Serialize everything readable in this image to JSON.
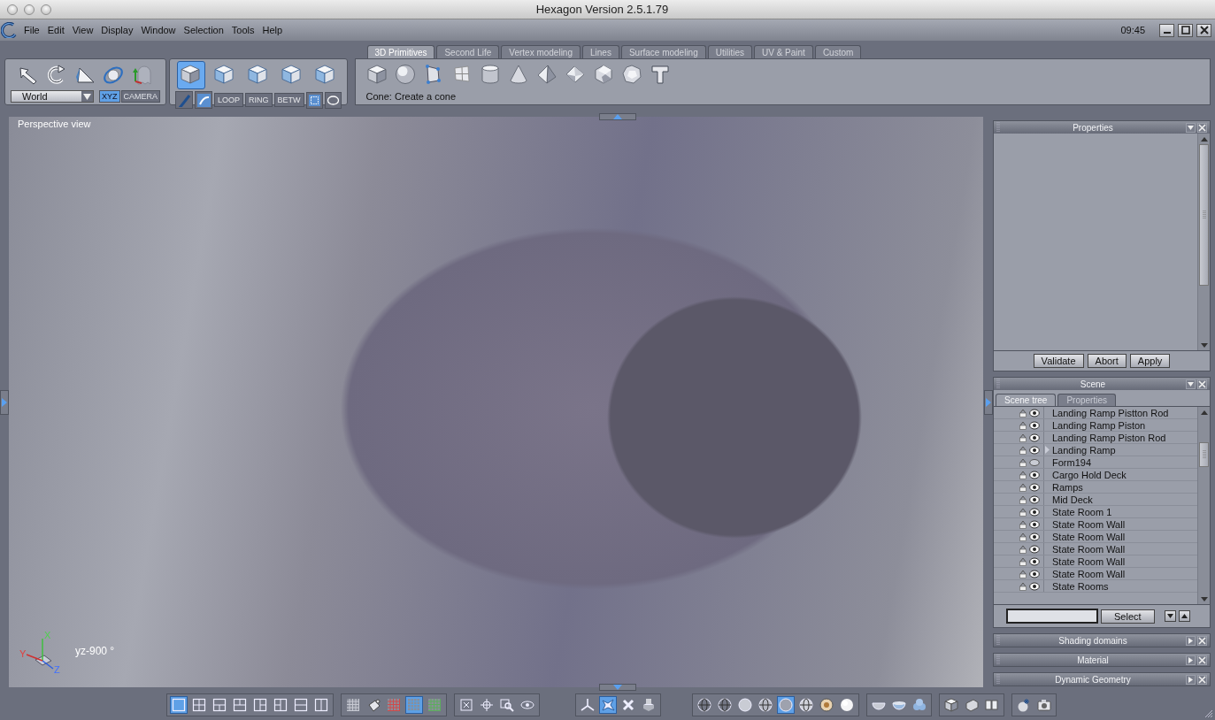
{
  "window": {
    "title": "Hexagon Version 2.5.1.79"
  },
  "menu": {
    "items": [
      "File",
      "Edit",
      "View",
      "Display",
      "Window",
      "Selection",
      "Tools",
      "Help"
    ],
    "clock": "09:45"
  },
  "left_toolbar": {
    "coordinate_space": "World",
    "space_toggles": [
      {
        "label": "XYZ",
        "selected": true
      },
      {
        "label": "CAMERA",
        "selected": false
      }
    ],
    "selection_modes": [
      {
        "selected": true
      },
      {
        "selected": false
      },
      {
        "selected": false
      },
      {
        "selected": false
      },
      {
        "selected": false
      }
    ],
    "edge_tools": [
      "LOOP",
      "RING",
      "BETW"
    ]
  },
  "tool_tabs": [
    {
      "label": "3D Primitives",
      "selected": true
    },
    {
      "label": "Second Life",
      "selected": false
    },
    {
      "label": "Vertex modeling",
      "selected": false
    },
    {
      "label": "Lines",
      "selected": false
    },
    {
      "label": "Surface modeling",
      "selected": false
    },
    {
      "label": "Utilities",
      "selected": false
    },
    {
      "label": "UV & Paint",
      "selected": false
    },
    {
      "label": "Custom",
      "selected": false
    }
  ],
  "tool_hint": "Cone: Create a cone",
  "viewport": {
    "label": "Perspective view",
    "axis_labels": [
      "X",
      "Y",
      "Z"
    ],
    "readout": "yz-900 °"
  },
  "properties_panel": {
    "title": "Properties",
    "buttons": [
      "Validate",
      "Abort",
      "Apply"
    ]
  },
  "scene_panel": {
    "title": "Scene",
    "tabs": [
      {
        "label": "Scene tree",
        "selected": true
      },
      {
        "label": "Properties",
        "selected": false
      }
    ],
    "rows": [
      {
        "name": "Landing Ramp Pistton Rod",
        "visible": true,
        "kind": "object"
      },
      {
        "name": "Landing Ramp Piston",
        "visible": true,
        "kind": "object"
      },
      {
        "name": "Landing Ramp Piston Rod",
        "visible": true,
        "kind": "object"
      },
      {
        "name": "Landing Ramp",
        "visible": true,
        "kind": "group"
      },
      {
        "name": "Form194",
        "visible": false,
        "kind": "object"
      },
      {
        "name": "Cargo Hold Deck",
        "visible": true,
        "kind": "object"
      },
      {
        "name": "Ramps",
        "visible": true,
        "kind": "object"
      },
      {
        "name": "Mid Deck",
        "visible": true,
        "kind": "object"
      },
      {
        "name": "State Room 1",
        "visible": true,
        "kind": "object"
      },
      {
        "name": "State Room Wall",
        "visible": true,
        "kind": "object"
      },
      {
        "name": "State Room Wall",
        "visible": true,
        "kind": "object"
      },
      {
        "name": "State Room Wall",
        "visible": true,
        "kind": "object"
      },
      {
        "name": "State Room Wall",
        "visible": true,
        "kind": "object"
      },
      {
        "name": "State Room Wall",
        "visible": true,
        "kind": "object"
      },
      {
        "name": "State Rooms",
        "visible": true,
        "kind": "object"
      }
    ],
    "select_button": "Select"
  },
  "collapsed_panels": [
    "Shading domains",
    "Material",
    "Dynamic Geometry"
  ],
  "bottom_toolbar": [
    {
      "buttons": [
        {
          "selected": true
        },
        {
          "selected": false
        },
        {
          "selected": false
        },
        {
          "selected": false
        },
        {
          "selected": false
        },
        {
          "selected": false
        },
        {
          "selected": false
        },
        {
          "selected": false
        }
      ]
    },
    {
      "buttons": [
        {
          "selected": false
        },
        {
          "selected": false
        },
        {
          "selected": false
        },
        {
          "selected": true
        },
        {
          "selected": false
        }
      ]
    },
    {
      "buttons": [
        {
          "selected": false
        },
        {
          "selected": false
        },
        {
          "selected": false
        },
        {
          "selected": false
        }
      ]
    },
    {
      "buttons": [
        {
          "selected": false
        },
        {
          "selected": true
        },
        {
          "selected": false
        },
        {
          "selected": false
        }
      ]
    },
    {
      "buttons": [
        {
          "selected": false
        },
        {
          "selected": false
        },
        {
          "selected": false
        },
        {
          "selected": false
        },
        {
          "selected": true
        },
        {
          "selected": false
        },
        {
          "selected": false
        },
        {
          "selected": false
        }
      ]
    },
    {
      "buttons": [
        {
          "selected": false
        },
        {
          "selected": false
        },
        {
          "selected": false
        }
      ]
    },
    {
      "buttons": [
        {
          "selected": false
        },
        {
          "selected": false
        },
        {
          "selected": false
        }
      ]
    },
    {
      "buttons": [
        {
          "selected": false
        },
        {
          "selected": false
        }
      ]
    }
  ]
}
